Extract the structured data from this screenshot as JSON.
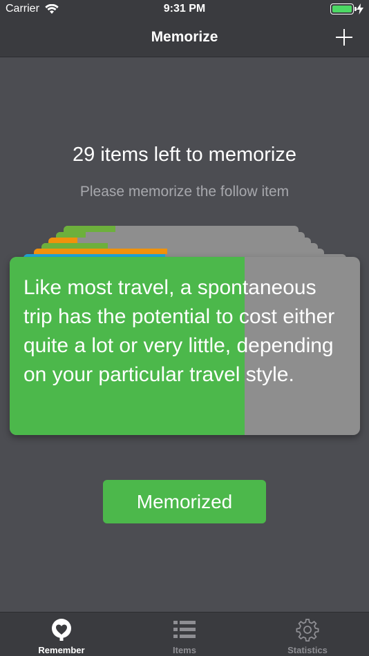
{
  "status_bar": {
    "carrier": "Carrier",
    "time": "9:31 PM"
  },
  "nav": {
    "title": "Memorize"
  },
  "main": {
    "items_left": "29 items left to memorize",
    "instruction": "Please memorize the follow item",
    "card_text": "Like most travel, a spontaneous trip has the potential to cost either quite a lot or very little, depending on your particular travel style.",
    "card_progress": 0.67,
    "memorized_label": "Memorized"
  },
  "stack": [
    {
      "progress": 0.22,
      "color": "#6db03c"
    },
    {
      "progress": 0.12,
      "color": "#6db03c"
    },
    {
      "progress": 0.11,
      "color": "#f1920b"
    },
    {
      "progress": 0.24,
      "color": "#6db03c"
    },
    {
      "progress": 0.46,
      "color": "#f1920b"
    },
    {
      "progress": 0.44,
      "color": "#1fa6d8"
    }
  ],
  "colors": {
    "accent_green": "#4cb84b",
    "background": "#4c4d52",
    "bar": "#3a3b3f",
    "tab_inactive": "#8e8e93"
  },
  "tabs": [
    {
      "label": "Remember",
      "icon": "remember-icon",
      "active": true
    },
    {
      "label": "Items",
      "icon": "list-icon",
      "active": false
    },
    {
      "label": "Statistics",
      "icon": "gear-icon",
      "active": false
    }
  ]
}
